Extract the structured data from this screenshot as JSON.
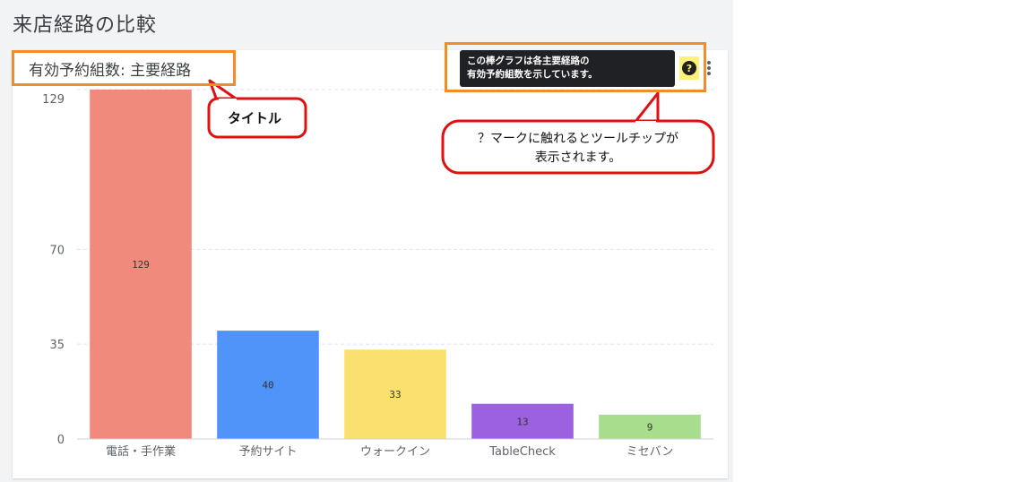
{
  "page": {
    "title": "来店経路の比較"
  },
  "card": {
    "title": "有効予約組数: 主要経路"
  },
  "tooltip": {
    "line1": "この棒グラフは各主要経路の",
    "line2": "有効予約組数を示しています。",
    "help_icon": "question-circle-icon",
    "menu_icon": "more-vertical-icon"
  },
  "callouts": {
    "title_label": "タイトル",
    "tooltip_line1": "？マークに触れるとツールチップが",
    "tooltip_line2": "表示されます。"
  },
  "colors": {
    "highlight_border": "#f28c28",
    "callout_border": "#e01010",
    "help_bg": "#fff17a"
  },
  "chart_data": {
    "type": "bar",
    "title": "有効予約組数: 主要経路",
    "categories": [
      "電話・手作業",
      "予約サイト",
      "ウォークイン",
      "TableCheck",
      "ミセバン"
    ],
    "values": [
      129,
      40,
      33,
      13,
      9
    ],
    "data_labels": [
      "129",
      "40",
      "33",
      "13",
      "9"
    ],
    "colors": [
      "#f08a7d",
      "#5094fa",
      "#fae06e",
      "#9b61e1",
      "#a8dd8d"
    ],
    "yticks": [
      0,
      35,
      70,
      129
    ],
    "ylim": [
      0,
      129
    ],
    "grid": true,
    "legend": "none"
  }
}
